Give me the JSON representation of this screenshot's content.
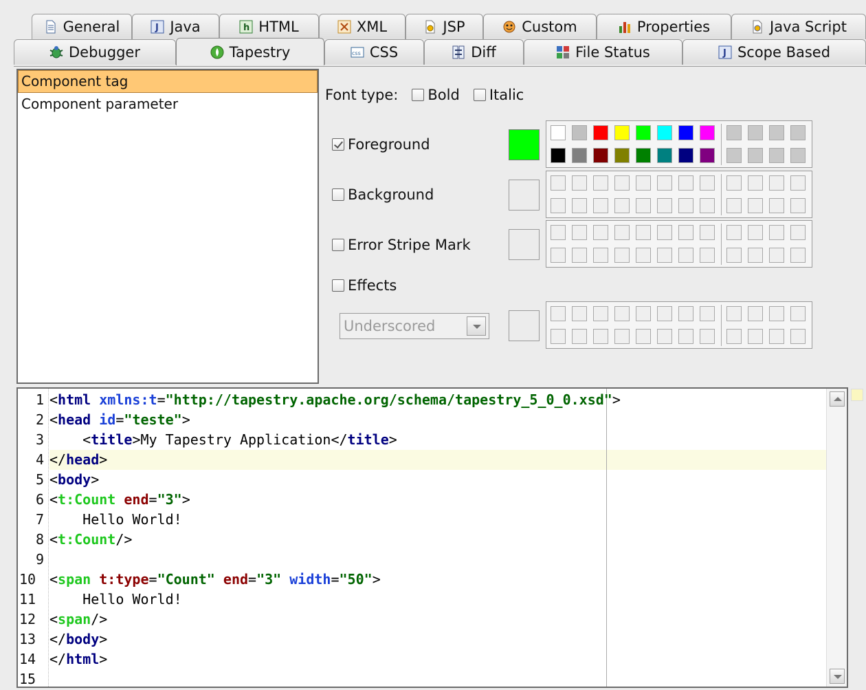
{
  "tabs_row1": [
    {
      "label": "General",
      "icon": "document-icon"
    },
    {
      "label": "Java",
      "icon": "java-icon"
    },
    {
      "label": "HTML",
      "icon": "html-icon"
    },
    {
      "label": "XML",
      "icon": "xml-icon"
    },
    {
      "label": "JSP",
      "icon": "jsp-icon"
    },
    {
      "label": "Custom",
      "icon": "custom-face-icon"
    },
    {
      "label": "Properties",
      "icon": "properties-bars-icon"
    },
    {
      "label": "Java Script",
      "icon": "javascript-icon"
    }
  ],
  "tabs_row2": [
    {
      "label": "Debugger",
      "icon": "debugger-bug-icon"
    },
    {
      "label": "Tapestry",
      "icon": "tapestry-icon",
      "active": true
    },
    {
      "label": "CSS",
      "icon": "css-icon"
    },
    {
      "label": "Diff",
      "icon": "diff-icon"
    },
    {
      "label": "File Status",
      "icon": "file-status-icon"
    },
    {
      "label": "Scope Based",
      "icon": "scope-based-icon"
    }
  ],
  "categories": {
    "items": [
      "Component tag",
      "Component parameter"
    ],
    "selected": "Component tag"
  },
  "font_type": {
    "label": "Font type:",
    "bold_label": "Bold",
    "italic_label": "Italic",
    "bold": false,
    "italic": false
  },
  "foreground": {
    "label": "Foreground",
    "checked": true,
    "color": "#00ff00"
  },
  "background": {
    "label": "Background",
    "checked": false
  },
  "error_stripe": {
    "label": "Error Stripe Mark",
    "checked": false
  },
  "effects": {
    "label": "Effects",
    "checked": false,
    "selected_option": "Underscored"
  },
  "palette_colors": {
    "row1": [
      "#ffffff",
      "#c0c0c0",
      "#ff0000",
      "#ffff00",
      "#00ff00",
      "#00ffff",
      "#0000ff",
      "#ff00ff"
    ],
    "row2": [
      "#000000",
      "#808080",
      "#800000",
      "#808000",
      "#008000",
      "#008080",
      "#000080",
      "#800080"
    ],
    "custom_empty": "#c8c8c8"
  },
  "preview": {
    "line_numbers": [
      "1",
      "2",
      "3",
      "4",
      "5",
      "6",
      "7",
      "8",
      "9",
      "10",
      "11",
      "12",
      "13",
      "14",
      "15"
    ],
    "current_line": 4,
    "lines": {
      "l1": {
        "lt": "<",
        "tag": "html",
        "sp": " ",
        "attr": "xmlns:t",
        "eq": "=",
        "val": "\"http://tapestry.apache.org/schema/tapestry_5_0_0.xsd\"",
        "gt": ">"
      },
      "l2": {
        "lt": "<",
        "tag": "head",
        "sp": " ",
        "attr": "id",
        "eq": "=",
        "val": "\"teste\"",
        "gt": ">"
      },
      "l3": {
        "indent": "    ",
        "lt": "<",
        "tag": "title",
        "gt": ">",
        "text": "My Tapestry Application",
        "lt2": "</",
        "tag2": "title",
        "gt2": ">"
      },
      "l4": {
        "lt": "</",
        "tag": "head",
        "gt": ">"
      },
      "l5": {
        "lt": "<",
        "tag": "body",
        "gt": ">"
      },
      "l6": {
        "lt": "<",
        "tag": "t:Count",
        "sp": " ",
        "attr": "end",
        "eq": "=",
        "val": "\"3\"",
        "gt": ">"
      },
      "l7": {
        "text": "    Hello World!"
      },
      "l8": {
        "lt": "<",
        "tag": "t:Count",
        "gt": "/>"
      },
      "l10": {
        "lt": "<",
        "tag": "span",
        "sp": " ",
        "attr1": "t:type",
        "eq1": "=",
        "val1": "\"Count\"",
        "sp2": " ",
        "attr2": "end",
        "eq2": "=",
        "val2": "\"3\"",
        "sp3": " ",
        "attr3": "width",
        "eq3": "=",
        "val3": "\"50\"",
        "gt": ">"
      },
      "l11": {
        "text": "    Hello World!"
      },
      "l12": {
        "lt": "<",
        "tag": "span",
        "gt": "/>"
      },
      "l13": {
        "lt": "</",
        "tag": "body",
        "gt": ">"
      },
      "l14": {
        "lt": "</",
        "tag": "html",
        "gt": ">"
      }
    }
  }
}
